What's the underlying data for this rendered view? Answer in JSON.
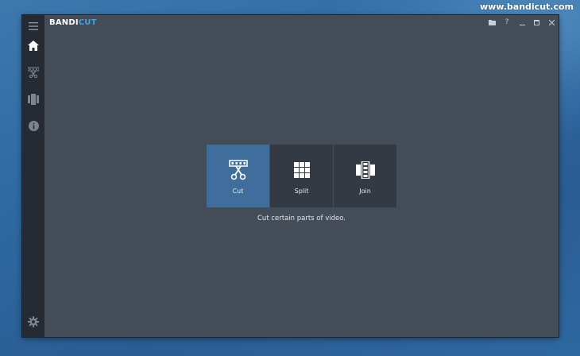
{
  "watermark": "www.bandicut.com",
  "app": {
    "brand_part1": "BANDI",
    "brand_part2": "CUT",
    "brand_color": "#3fa3e6"
  },
  "sidebar": {
    "items": [
      {
        "icon": "menu-icon"
      },
      {
        "icon": "home-icon"
      },
      {
        "icon": "cut-mode-icon"
      },
      {
        "icon": "join-mode-icon"
      },
      {
        "icon": "info-icon"
      },
      {
        "icon": "gear-icon"
      }
    ]
  },
  "window_controls": [
    "folder-icon",
    "help-icon",
    "minimize-icon",
    "maximize-icon",
    "close-icon"
  ],
  "modes": [
    {
      "label": "Cut",
      "icon": "scissors-film-icon",
      "selected": true
    },
    {
      "label": "Split",
      "icon": "grid-icon",
      "selected": false
    },
    {
      "label": "Join",
      "icon": "film-join-icon",
      "selected": false
    }
  ],
  "description": "Cut certain parts of video.",
  "colors": {
    "window_bg": "#444c58",
    "sidebar_bg": "#262b33",
    "tile_bg": "#343a43",
    "tile_active_bg": "#3f6e9c"
  }
}
